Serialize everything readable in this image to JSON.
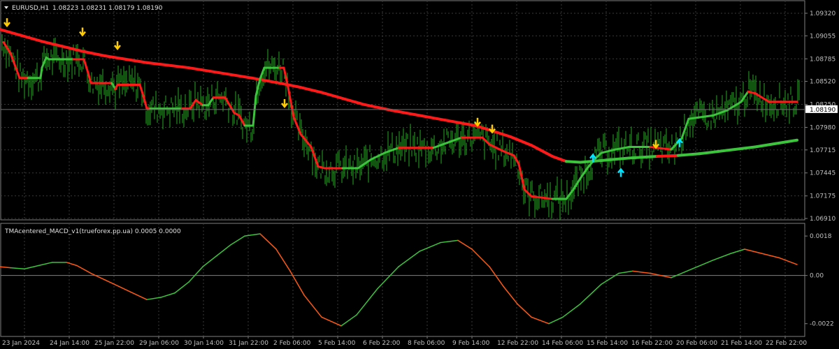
{
  "header": {
    "symbol": "EURUSD,H1",
    "ohlc": "1.08223 1.08231 1.08179 1.08190"
  },
  "indicator": {
    "title": "TMAcentered_MACD_v1(trueforex.pp.ua) 0.0005 0.0000"
  },
  "colors": {
    "background": "#000000",
    "grid": "#3a3a3a",
    "price_bars": "#22aa22",
    "tma_up": "#3cc43c",
    "tma_down": "#ff1a1a",
    "macd_up": "#3cc43c",
    "macd_down": "#ff5a14",
    "arrow_sell": "#ffcc00",
    "arrow_buy": "#00e5ff",
    "axis_text": "#c0c0c0"
  },
  "chart_data": [
    {
      "type": "line",
      "name": "price-panel",
      "x_labels": [
        "23 Jan 2024",
        "24 Jan 14:00",
        "25 Jan 22:00",
        "29 Jan 06:00",
        "30 Jan 14:00",
        "31 Jan 22:00",
        "2 Feb 06:00",
        "5 Feb 14:00",
        "6 Feb 22:00",
        "8 Feb 06:00",
        "9 Feb 14:00",
        "12 Feb 22:00",
        "14 Feb 06:00",
        "15 Feb 14:00",
        "16 Feb 22:00",
        "20 Feb 06:00",
        "21 Feb 14:00",
        "22 Feb 22:00"
      ],
      "y_ticks": [
        "1.09320",
        "1.09055",
        "1.08785",
        "1.08520",
        "1.08250",
        "1.07980",
        "1.07715",
        "1.07445",
        "1.07175",
        "1.06910"
      ],
      "current_price": "1.08190",
      "ylim": [
        1.0691,
        1.0932
      ],
      "series": [
        {
          "style": "tma_long",
          "x": [
            0,
            30,
            60,
            90,
            120,
            150,
            180,
            210,
            240,
            270,
            300,
            330,
            360,
            400,
            430,
            460,
            490,
            520,
            560,
            600,
            640,
            680,
            700,
            730,
            760,
            790,
            810,
            830,
            860,
            900,
            940,
            970,
            1000,
            1040,
            1080,
            1110,
            1140
          ],
          "y": [
            1.0913,
            1.0906,
            1.0899,
            1.0893,
            1.0887,
            1.0882,
            1.0878,
            1.0874,
            1.0871,
            1.0868,
            1.0864,
            1.086,
            1.0856,
            1.085,
            1.0845,
            1.0839,
            1.0832,
            1.0825,
            1.0818,
            1.0812,
            1.0806,
            1.08,
            1.0795,
            1.0787,
            1.0777,
            1.0764,
            1.0758,
            1.0757,
            1.0759,
            1.0762,
            1.0764,
            1.0765,
            1.0767,
            1.0771,
            1.0775,
            1.0779,
            1.0783
          ],
          "state": [
            "d",
            "d",
            "d",
            "d",
            "d",
            "d",
            "d",
            "d",
            "d",
            "d",
            "d",
            "d",
            "d",
            "d",
            "d",
            "d",
            "d",
            "d",
            "d",
            "d",
            "d",
            "d",
            "d",
            "d",
            "d",
            "d",
            "d",
            "u",
            "u",
            "u",
            "u",
            "d",
            "u",
            "u",
            "u",
            "u",
            "u"
          ]
        },
        {
          "style": "tma_step",
          "x": [
            5,
            15,
            28,
            32,
            40,
            58,
            60,
            66,
            70,
            90,
            105,
            120,
            126,
            130,
            160,
            165,
            168,
            200,
            205,
            210,
            215,
            260,
            272,
            280,
            290,
            298,
            305,
            322,
            335,
            342,
            350,
            362,
            366,
            372,
            378,
            400,
            406,
            412,
            420,
            430,
            445,
            455,
            465,
            490,
            512,
            530,
            550,
            570,
            590,
            620,
            640,
            660,
            680,
            690,
            700,
            720,
            735,
            742,
            750,
            760,
            790,
            810,
            820,
            830,
            840,
            850,
            860,
            880,
            900,
            930,
            960,
            975,
            985,
            1020,
            1040,
            1060,
            1070,
            1080,
            1100,
            1140
          ],
          "y": [
            1.0898,
            1.0885,
            1.0856,
            1.0856,
            1.0856,
            1.0856,
            1.0868,
            1.088,
            1.0878,
            1.0878,
            1.0878,
            1.0878,
            1.0862,
            1.085,
            1.085,
            1.0843,
            1.0848,
            1.0848,
            1.0835,
            1.082,
            1.082,
            1.082,
            1.082,
            1.083,
            1.0824,
            1.0824,
            1.0833,
            1.0833,
            1.0815,
            1.0812,
            1.08,
            1.08,
            1.0835,
            1.0855,
            1.0868,
            1.0868,
            1.0868,
            1.0845,
            1.081,
            1.079,
            1.0775,
            1.0752,
            1.075,
            1.075,
            1.075,
            1.076,
            1.0768,
            1.0774,
            1.0774,
            1.0774,
            1.078,
            1.0786,
            1.0786,
            1.0786,
            1.0778,
            1.077,
            1.0765,
            1.0755,
            1.0725,
            1.0717,
            1.0714,
            1.0714,
            1.0725,
            1.0738,
            1.075,
            1.076,
            1.0768,
            1.0772,
            1.0775,
            1.0775,
            1.0772,
            1.0785,
            1.0808,
            1.0812,
            1.0818,
            1.0828,
            1.084,
            1.0838,
            1.0828,
            1.0828
          ],
          "state": [
            "d",
            "d",
            "d",
            "d",
            "d",
            "u",
            "u",
            "u",
            "u",
            "u",
            "u",
            "d",
            "d",
            "d",
            "d",
            "u",
            "d",
            "d",
            "d",
            "d",
            "d",
            "u",
            "d",
            "d",
            "d",
            "u",
            "u",
            "d",
            "d",
            "d",
            "d",
            "u",
            "u",
            "u",
            "u",
            "u",
            "d",
            "d",
            "d",
            "d",
            "d",
            "d",
            "d",
            "d",
            "u",
            "u",
            "u",
            "u",
            "d",
            "d",
            "u",
            "u",
            "d",
            "d",
            "d",
            "d",
            "d",
            "d",
            "d",
            "d",
            "d",
            "u",
            "u",
            "u",
            "u",
            "u",
            "u",
            "u",
            "u",
            "u",
            "d",
            "u",
            "u",
            "u",
            "u",
            "u",
            "u",
            "d",
            "d",
            "d"
          ]
        }
      ],
      "arrows_sell": [
        [
          10,
          1.0918
        ],
        [
          118,
          1.0907
        ],
        [
          168,
          1.0891
        ],
        [
          407,
          1.0823
        ],
        [
          683,
          1.0801
        ],
        [
          704,
          1.0793
        ],
        [
          938,
          1.0775
        ]
      ],
      "arrows_buy": [
        [
          848,
          1.0765
        ],
        [
          888,
          1.0748
        ],
        [
          972,
          1.0783
        ]
      ]
    },
    {
      "type": "line",
      "name": "macd-panel",
      "y_ticks": [
        "0.0018",
        "0.00",
        "-0.0022"
      ],
      "ylim": [
        -0.0024,
        0.0019
      ],
      "series": [
        {
          "x": [
            0,
            15,
            35,
            55,
            75,
            95,
            110,
            130,
            150,
            170,
            190,
            210,
            230,
            250,
            270,
            290,
            310,
            330,
            350,
            372,
            395,
            415,
            435,
            460,
            488,
            510,
            540,
            570,
            600,
            630,
            655,
            675,
            700,
            720,
            740,
            760,
            785,
            805,
            830,
            860,
            885,
            905,
            930,
            960,
            990,
            1020,
            1045,
            1065,
            1090,
            1115,
            1140
          ],
          "y": [
            0.0004,
            0.00035,
            0.0003,
            0.00045,
            0.0006,
            0.0006,
            0.00045,
            0.0001,
            -0.0002,
            -0.0005,
            -0.0008,
            -0.0011,
            -0.001,
            -0.0008,
            -0.0003,
            0.0004,
            0.0009,
            0.0014,
            0.0018,
            0.0019,
            0.0012,
            0.0002,
            -0.0009,
            -0.0019,
            -0.0023,
            -0.0018,
            -0.0006,
            0.0004,
            0.0011,
            0.0015,
            0.0016,
            0.0012,
            0.0004,
            -0.0005,
            -0.0013,
            -0.0019,
            -0.0022,
            -0.0019,
            -0.0013,
            -0.0004,
            0.0001,
            0.0002,
            0.0001,
            -0.0001,
            0.0003,
            0.0007,
            0.001,
            0.0012,
            0.001,
            0.0008,
            0.0005
          ],
          "state": [
            "d",
            "d",
            "u",
            "u",
            "u",
            "u",
            "d",
            "d",
            "d",
            "d",
            "d",
            "d",
            "u",
            "u",
            "u",
            "u",
            "u",
            "u",
            "u",
            "u",
            "d",
            "d",
            "d",
            "d",
            "d",
            "u",
            "u",
            "u",
            "u",
            "u",
            "u",
            "d",
            "d",
            "d",
            "d",
            "d",
            "d",
            "u",
            "u",
            "u",
            "u",
            "u",
            "d",
            "d",
            "u",
            "u",
            "u",
            "u",
            "d",
            "d",
            "d"
          ]
        }
      ]
    }
  ]
}
